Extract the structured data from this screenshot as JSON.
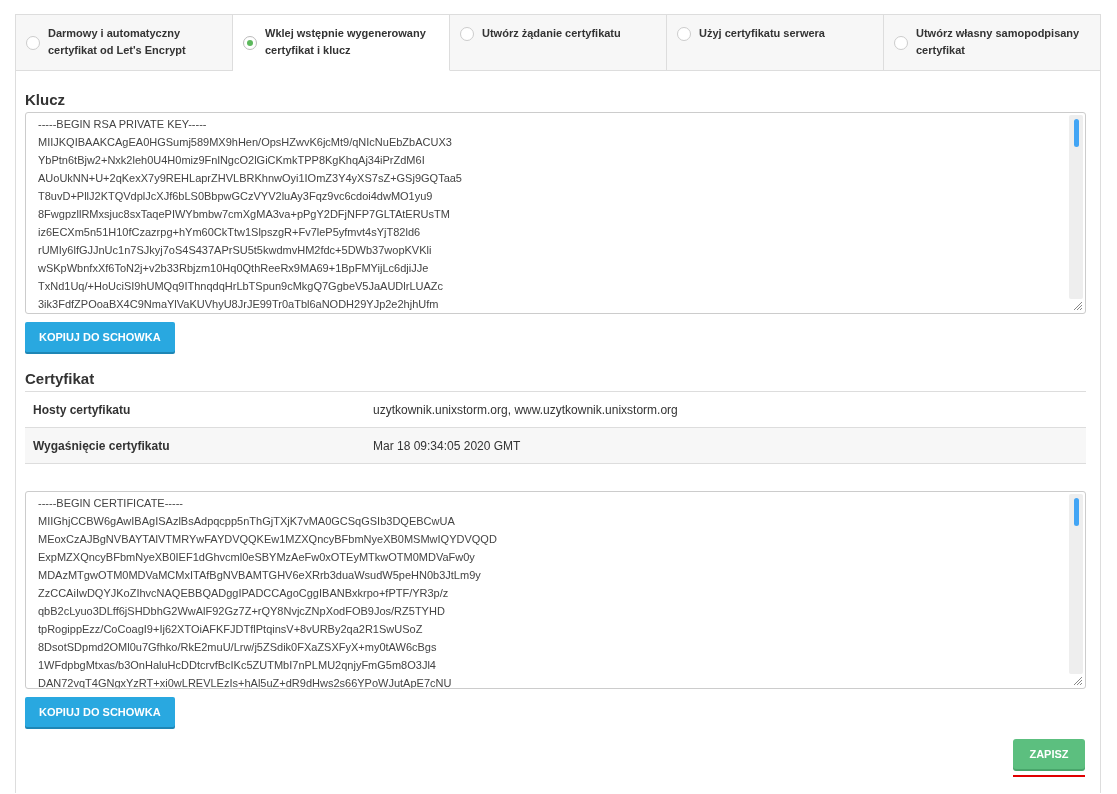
{
  "tabs": [
    {
      "label": "Darmowy i automatyczny certyfikat od Let's Encrypt",
      "selected": false
    },
    {
      "label": "Wklej wstępnie wygenerowany certyfikat i klucz",
      "selected": true
    },
    {
      "label": "Utwórz żądanie certyfikatu",
      "selected": false
    },
    {
      "label": "Użyj certyfikatu serwera",
      "selected": false
    },
    {
      "label": "Utwórz własny samopodpisany certyfikat",
      "selected": false
    }
  ],
  "key_section": {
    "heading": "Klucz",
    "lines": [
      "-----BEGIN RSA PRIVATE KEY-----",
      "MIIJKQIBAAKCAgEA0HGSumj589MX9hHen/OpsHZwvK6jcMt9/qNIcNuEbZbACUX3",
      "YbPtn6tBjw2+Nxk2leh0U4H0miz9FnlNgcO2lGiCKmkTPP8KgKhqAj34iPrZdM6I",
      "AUoUkNN+U+2qKexX7y9REHLaprZHVLBRKhnwOyi1IOmZ3Y4yXS7sZ+GSj9GQTaa5",
      "T8uvD+PllJ2KTQVdplJcXJf6bLS0BbpwGCzVYV2luAy3Fqz9vc6cdoi4dwMO1yu9",
      "8FwgpzllRMxsjuc8sxTaqePIWYbmbw7cmXgMA3va+pPgY2DFjNFP7GLTAtERUsTM",
      "iz6ECXm5n51H10fCzazrpg+hYm60CkTtw1SlpszgR+Fv7leP5yfmvt4sYjT82ld6",
      "rUMIy6lfGJJnUc1n7SJkyj7oS4S437APrSU5t5kwdmvHM2fdc+5DWb37wopKVKli",
      "wSKpWbnfxXf6ToN2j+v2b33Rbjzm10Hq0QthReeRx9MA69+1BpFMYijLc6djiJJe",
      "TxNd1Uq/+HoUciSI9hUMQq9IThnqdqHrLbTSpun9cMkgQ7GgbeV5JaAUDlrLUAZc",
      "3ik3FdfZPOoaBX4C9NmaYlVaKUVhyU8JrJE99Tr0aTbl6aNODH29YJp2e2hjhUfm"
    ],
    "copy_button": "KOPIUJ DO SCHOWKA"
  },
  "certificate_section": {
    "heading": "Certyfikat",
    "rows": [
      {
        "label": "Hosty certyfikatu",
        "value": "uzytkownik.unixstorm.org, www.uzytkownik.unixstorm.org"
      },
      {
        "label": "Wygaśnięcie certyfikatu",
        "value": "Mar 18 09:34:05 2020 GMT"
      }
    ],
    "lines": [
      "-----BEGIN CERTIFICATE-----",
      "MIIGhjCCBW6gAwIBAgISAzlBsAdpqcpp5nThGjTXjK7vMA0GCSqGSIb3DQEBCwUA",
      "MEoxCzAJBgNVBAYTAlVTMRYwFAYDVQQKEw1MZXQncyBFbmNyeXB0MSMwIQYDVQQD",
      "ExpMZXQncyBFbmNyeXB0IEF1dGhvcml0eSBYMzAeFw0xOTEyMTkwOTM0MDVaFw0y",
      "MDAzMTgwOTM0MDVaMCMxITAfBgNVBAMTGHV6eXRrb3duaWsudW5peHN0b3JtLm9y",
      "ZzCCAiIwDQYJKoZIhvcNAQEBBQADggIPADCCAgoCggIBANBxkrpo+fPTF/YR3p/z",
      "qbB2cLyuo3DLff6jSHDbhG2WwAlF92Gz7Z+rQY8NvjcZNpXodFOB9Jos/RZ5TYHD",
      "tpRogippEzz/CoCoagI9+Ij62XTOiAFKFJDTflPtqinsV+8vURBy2qa2R1SwUSoZ",
      "8DsotSDpmd2OMl0u7Gfhko/RkE2muU/Lrw/j5ZSdik0FXaZSXFyX+my0tAW6cBgs",
      "1WFdpbgMtxas/b3OnHaluHcDDtcrvfBcIKc5ZUTMbI7nPLMU2qnjyFmG5m8O3Jl4",
      "DAN72vqT4GNgxYzRT+xi0wLREVLEzIs+hAl5uZ+dR9dHws2s66YPoWJutApE7cNU"
    ],
    "copy_button": "KOPIUJ DO SCHOWKA"
  },
  "save_button": "ZAPISZ"
}
